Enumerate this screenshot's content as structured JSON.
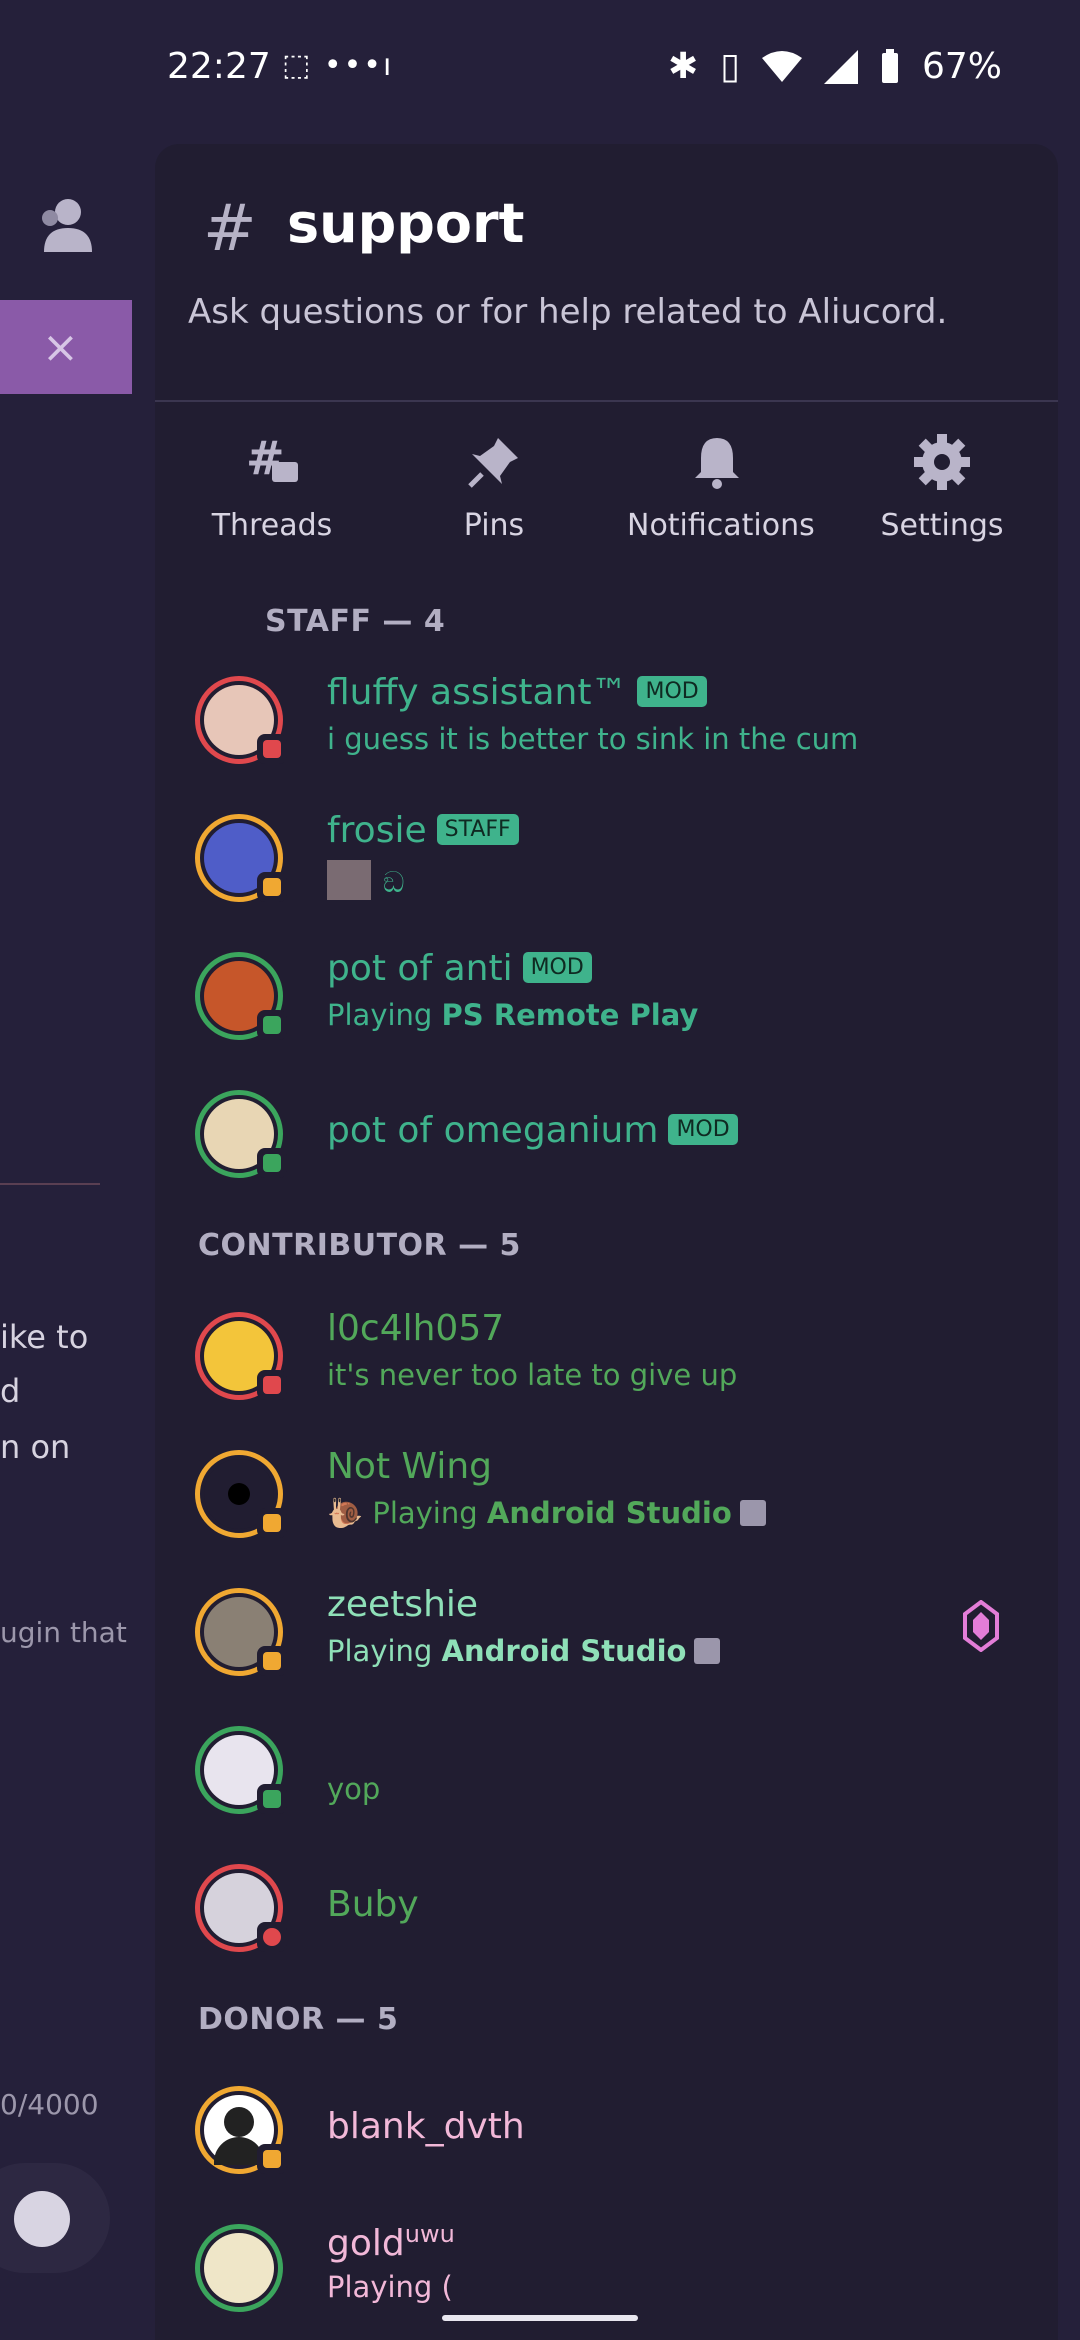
{
  "status_bar": {
    "time": "22:27",
    "left_icons": "⬚ •••ı",
    "battery": "67%"
  },
  "background": {
    "lines": [
      "ike to",
      "d",
      "n on"
    ],
    "plugin_line": "ugin that",
    "counter": "0/4000",
    "close_label": "×"
  },
  "channel": {
    "hash": "#",
    "name": "support",
    "topic": "Ask questions or for help related to Aliucord."
  },
  "actions": [
    {
      "label": "Threads",
      "icon": "threads-icon"
    },
    {
      "label": "Pins",
      "icon": "pin-icon"
    },
    {
      "label": "Notifications",
      "icon": "bell-icon"
    },
    {
      "label": "Settings",
      "icon": "gear-icon"
    }
  ],
  "sections": {
    "staff": "STAFF — 4",
    "contributor": "CONTRIBUTOR — 5",
    "donor": "DONOR — 5"
  },
  "members": {
    "fluffy": {
      "name": "fluffy assistant™",
      "badge": "MOD",
      "sub": "i guess it is better to sink in the cum"
    },
    "frosie": {
      "name": "frosie",
      "badge": "STAFF",
      "sub": "ඞ"
    },
    "anti": {
      "name": "pot of anti",
      "badge": "MOD",
      "sub_prefix": "Playing ",
      "sub_bold": "PS Remote Play"
    },
    "omeganium": {
      "name": "pot of omeganium",
      "badge": "MOD"
    },
    "l0c": {
      "name": "l0c4lh057",
      "sub": "it's never too late to give up"
    },
    "notwing": {
      "name": "Not Wing",
      "sub_emoji": "🐌",
      "sub_prefix": " Playing ",
      "sub_bold": "Android Studio"
    },
    "zeetshie": {
      "name": "zeetshie",
      "sub_prefix": "Playing ",
      "sub_bold": "Android Studio"
    },
    "yop": {
      "name": "",
      "sub": "yop"
    },
    "buby": {
      "name": "Buby"
    },
    "blank": {
      "name": "blank_dvth"
    },
    "gold": {
      "name": "gold",
      "sup": "uwu",
      "sub_prefix": "Playing ("
    }
  },
  "colors": {
    "mod_green": "#3fb38c",
    "contributor_green": "#52a85a",
    "donor_pink": "#f2b8d8",
    "online": "#3ba55d",
    "idle": "#f0a832",
    "dnd": "#e0484d"
  }
}
